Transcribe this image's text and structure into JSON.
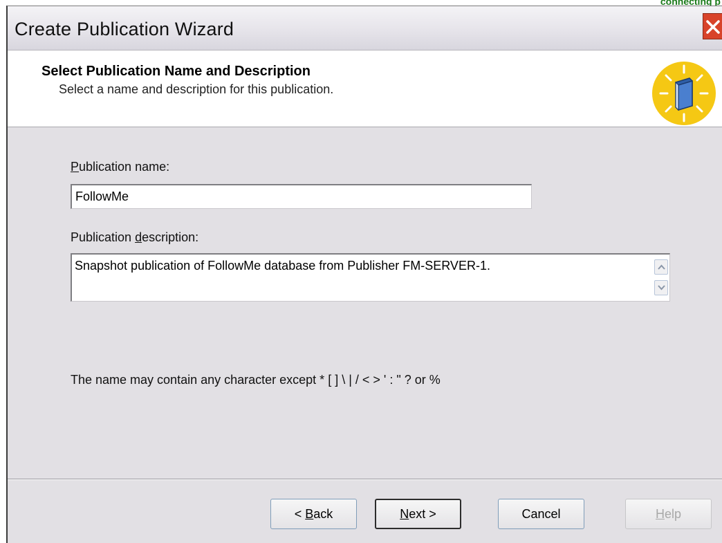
{
  "corner_text": "connecting p",
  "window": {
    "title": "Create Publication Wizard"
  },
  "header": {
    "title": "Select Publication Name and Description",
    "subtitle": "Select a name and description for this publication."
  },
  "form": {
    "name_label_underlined": "P",
    "name_label_rest": "ublication name:",
    "name_value": "FollowMe",
    "description_label_start": "Publication ",
    "description_label_underlined": "d",
    "description_label_rest": "escription:",
    "description_value": "Snapshot publication of FollowMe database from Publisher FM-SERVER-1.",
    "hint": "The name may contain any character except * [ ] \\ | / < > ' : \" ? or %"
  },
  "buttons": {
    "back": {
      "prefix": "< ",
      "underlined": "B",
      "rest": "ack"
    },
    "next": {
      "prefix": "",
      "underlined": "N",
      "rest": "ext >"
    },
    "cancel": {
      "label": "Cancel"
    },
    "help": {
      "prefix": "",
      "underlined": "H",
      "rest": "elp"
    }
  },
  "colors": {
    "dialog_background": "#e2e0e4",
    "close_button": "#d8432a",
    "icon_yellow": "#f5c814"
  }
}
